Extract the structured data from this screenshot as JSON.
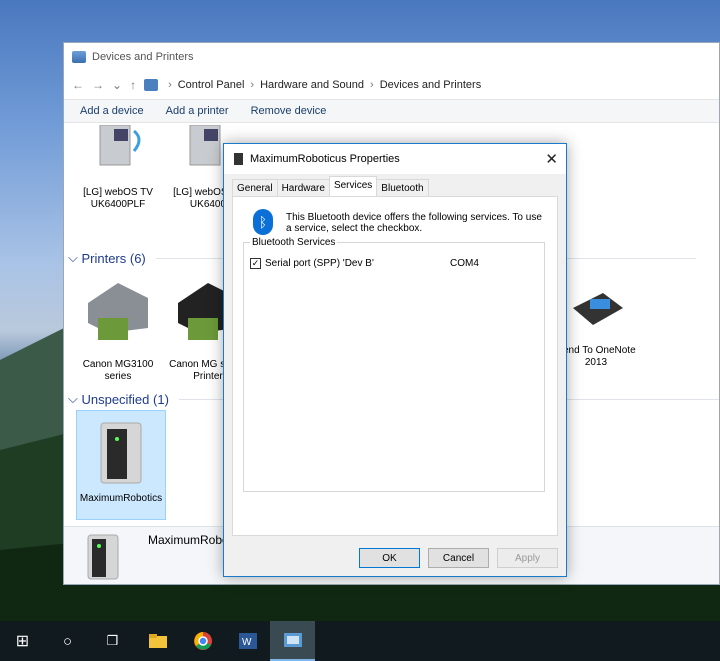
{
  "explorer": {
    "title": "Devices and Printers",
    "breadcrumb": [
      "Control Panel",
      "Hardware and Sound",
      "Devices and Printers"
    ],
    "toolbar": [
      "Add a device",
      "Add a printer",
      "Remove device"
    ],
    "devices": [
      {
        "label": "[LG] webOS TV UK6400PLF"
      },
      {
        "label": "[LG] webOS TV UK6400"
      }
    ],
    "printers_group": "Printers (6)",
    "printers": [
      {
        "label": "Canon MG3100 series"
      },
      {
        "label": "Canon MG series Printer"
      },
      {
        "label": "Send To OneNote 2013"
      }
    ],
    "unspecified_group": "Unspecified (1)",
    "unspecified": [
      {
        "label": "MaximumRobotics"
      }
    ],
    "detail_name": "MaximumRobot"
  },
  "dialog": {
    "title": "MaximumRoboticus Properties",
    "close": "✕",
    "tabs": [
      "General",
      "Hardware",
      "Services",
      "Bluetooth"
    ],
    "active_tab": "Services",
    "description": "This Bluetooth device offers the following services. To use a service, select the checkbox.",
    "services_legend": "Bluetooth Services",
    "service": {
      "name": "Serial port (SPP) 'Dev B'",
      "port": "COM4",
      "checked": "✓"
    },
    "buttons": {
      "ok": "OK",
      "cancel": "Cancel",
      "apply": "Apply"
    }
  },
  "taskbar": {
    "start": "⊞",
    "search": "○",
    "taskview": "❒"
  }
}
